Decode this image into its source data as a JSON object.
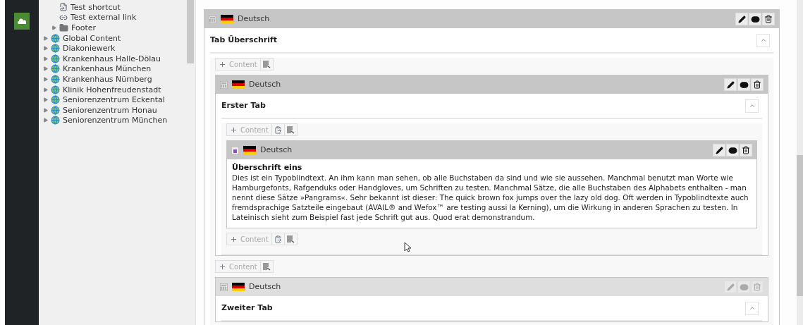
{
  "tree": {
    "partial_children": [
      {
        "kind": "shortcut",
        "label": "Test shortcut"
      },
      {
        "kind": "link",
        "label": "Test external link"
      },
      {
        "kind": "folder",
        "label": "Footer",
        "expanded": false
      }
    ],
    "items": [
      {
        "kind": "site",
        "label": "Global Content",
        "expanded": false
      },
      {
        "kind": "site",
        "label": "Diakoniewerk",
        "expanded": false
      },
      {
        "kind": "site",
        "label": "Krankenhaus Halle-Dölau",
        "expanded": false
      },
      {
        "kind": "site",
        "label": "Krankenhaus München",
        "expanded": false
      },
      {
        "kind": "site",
        "label": "Krankenhaus Nürnberg",
        "expanded": false
      },
      {
        "kind": "site",
        "label": "Klinik Hohenfreudenstadt",
        "expanded": false
      },
      {
        "kind": "site",
        "label": "Seniorenzentrum Eckental",
        "expanded": false
      },
      {
        "kind": "site",
        "label": "Seniorenzentrum Honau",
        "expanded": false
      },
      {
        "kind": "site",
        "label": "Seniorenzentrum München",
        "expanded": false
      }
    ]
  },
  "page": {
    "kind": "grid",
    "language": "Deutsch",
    "actions_disabled": false,
    "title": "Tab Überschrift",
    "expanded": true,
    "items": [
      {
        "kind": "dropzone",
        "label": "Content",
        "paste": false
      },
      {
        "kind": "element",
        "element": {
          "kind": "grid",
          "language": "Deutsch",
          "actions_disabled": false,
          "title": "Erster Tab",
          "expanded": true,
          "items": [
            {
              "kind": "dropzone",
              "label": "Content",
              "paste": true
            },
            {
              "kind": "element",
              "element": {
                "kind": "text",
                "language": "Deutsch",
                "actions_disabled": false,
                "heading": "Überschrift eins",
                "body": "Dies ist ein Typoblindtext. An ihm kann man sehen, ob alle Buchstaben da sind und wie sie aussehen. Manchmal benutzt man Worte wie Hamburgefonts, Rafgenduks oder Handgloves, um Schriften zu testen. Manchmal Sätze, die alle Buchstaben des Alphabets enthalten - man nennt diese Sätze »Pangrams«. Sehr bekannt ist dieser: The quick brown fox jumps over the lazy old dog. Oft werden in Typoblindtexte auch fremdsprachige Satzteile eingebaut (AVAIL® and Wefox™ are testing aussi la Kerning), um die Wirkung in anderen Sprachen zu testen. In Lateinisch sieht zum Beispiel fast jede Schrift gut aus. Quod erat demonstrandum."
              }
            },
            {
              "kind": "dropzone",
              "label": "Content",
              "paste": true
            }
          ]
        }
      },
      {
        "kind": "dropzone",
        "label": "Content",
        "paste": false
      },
      {
        "kind": "element",
        "element": {
          "kind": "grid",
          "language": "Deutsch",
          "actions_disabled": true,
          "title": "Zweiter Tab",
          "expanded": true
        }
      }
    ]
  }
}
